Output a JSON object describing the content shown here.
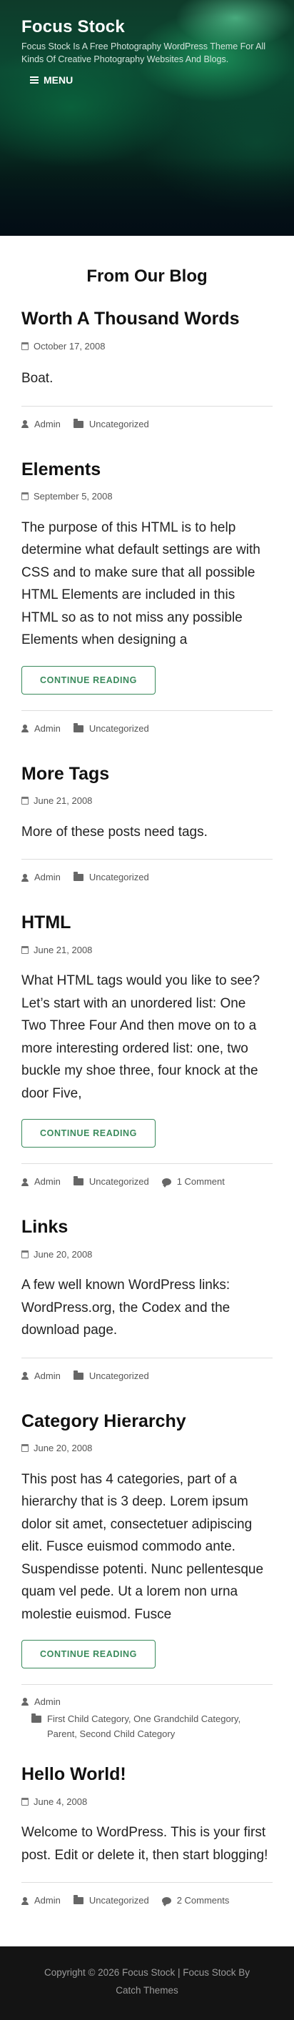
{
  "header": {
    "site_title": "Focus Stock",
    "site_description": "Focus Stock Is A Free Photography WordPress Theme For All Kinds Of Creative Photography Websites And Blogs.",
    "menu_label": "MENU"
  },
  "section_title": "From Our Blog",
  "read_more_label": "CONTINUE READING",
  "posts": [
    {
      "title": "Worth A Thousand Words",
      "date": "October 17, 2008",
      "excerpt": "Boat.",
      "author": "Admin",
      "category": "Uncategorized"
    },
    {
      "title": "Elements",
      "date": "September 5, 2008",
      "excerpt": "The purpose of this HTML is to help determine what default settings are with CSS and to make sure that all possible HTML Elements are included in this HTML so as to not miss any possible Elements when designing a",
      "author": "Admin",
      "category": "Uncategorized"
    },
    {
      "title": "More Tags",
      "date": "June 21, 2008",
      "excerpt": "More of these posts need tags.",
      "author": "Admin",
      "category": "Uncategorized"
    },
    {
      "title": "HTML",
      "date": "June 21, 2008",
      "excerpt": "What HTML tags would you like to see? Let’s start with an unordered list: One Two Three Four And then move on to a more interesting ordered list: one, two buckle my shoe three, four knock at the door Five,",
      "author": "Admin",
      "category": "Uncategorized",
      "comments": "1 Comment"
    },
    {
      "title": "Links",
      "date": "June 20, 2008",
      "excerpt": "A few well known WordPress links: WordPress.org, the Codex and the download page.",
      "author": "Admin",
      "category": "Uncategorized"
    },
    {
      "title": "Category Hierarchy",
      "date": "June 20, 2008",
      "excerpt": "This post has 4 categories, part of a hierarchy that is 3 deep. Lorem ipsum dolor sit amet, consectetuer adipiscing elit. Fusce euismod commodo ante. Suspendisse potenti. Nunc pellentesque quam vel pede. Ut a lorem non urna molestie euismod. Fusce",
      "author": "Admin",
      "categories": "First Child Category, One Grandchild Category, Parent, Second Child Category"
    },
    {
      "title": "Hello World!",
      "date": "June 4, 2008",
      "excerpt": "Welcome to WordPress. This is your first post. Edit or delete it, then start blogging!",
      "author": "Admin",
      "category": "Uncategorized",
      "comments": "2 Comments"
    }
  ],
  "footer": {
    "copyright": "Copyright © 2026 Focus Stock | Focus Stock By Catch Themes"
  },
  "colors": {
    "accent": "#3a8a5c",
    "footer_bg": "#141414"
  }
}
